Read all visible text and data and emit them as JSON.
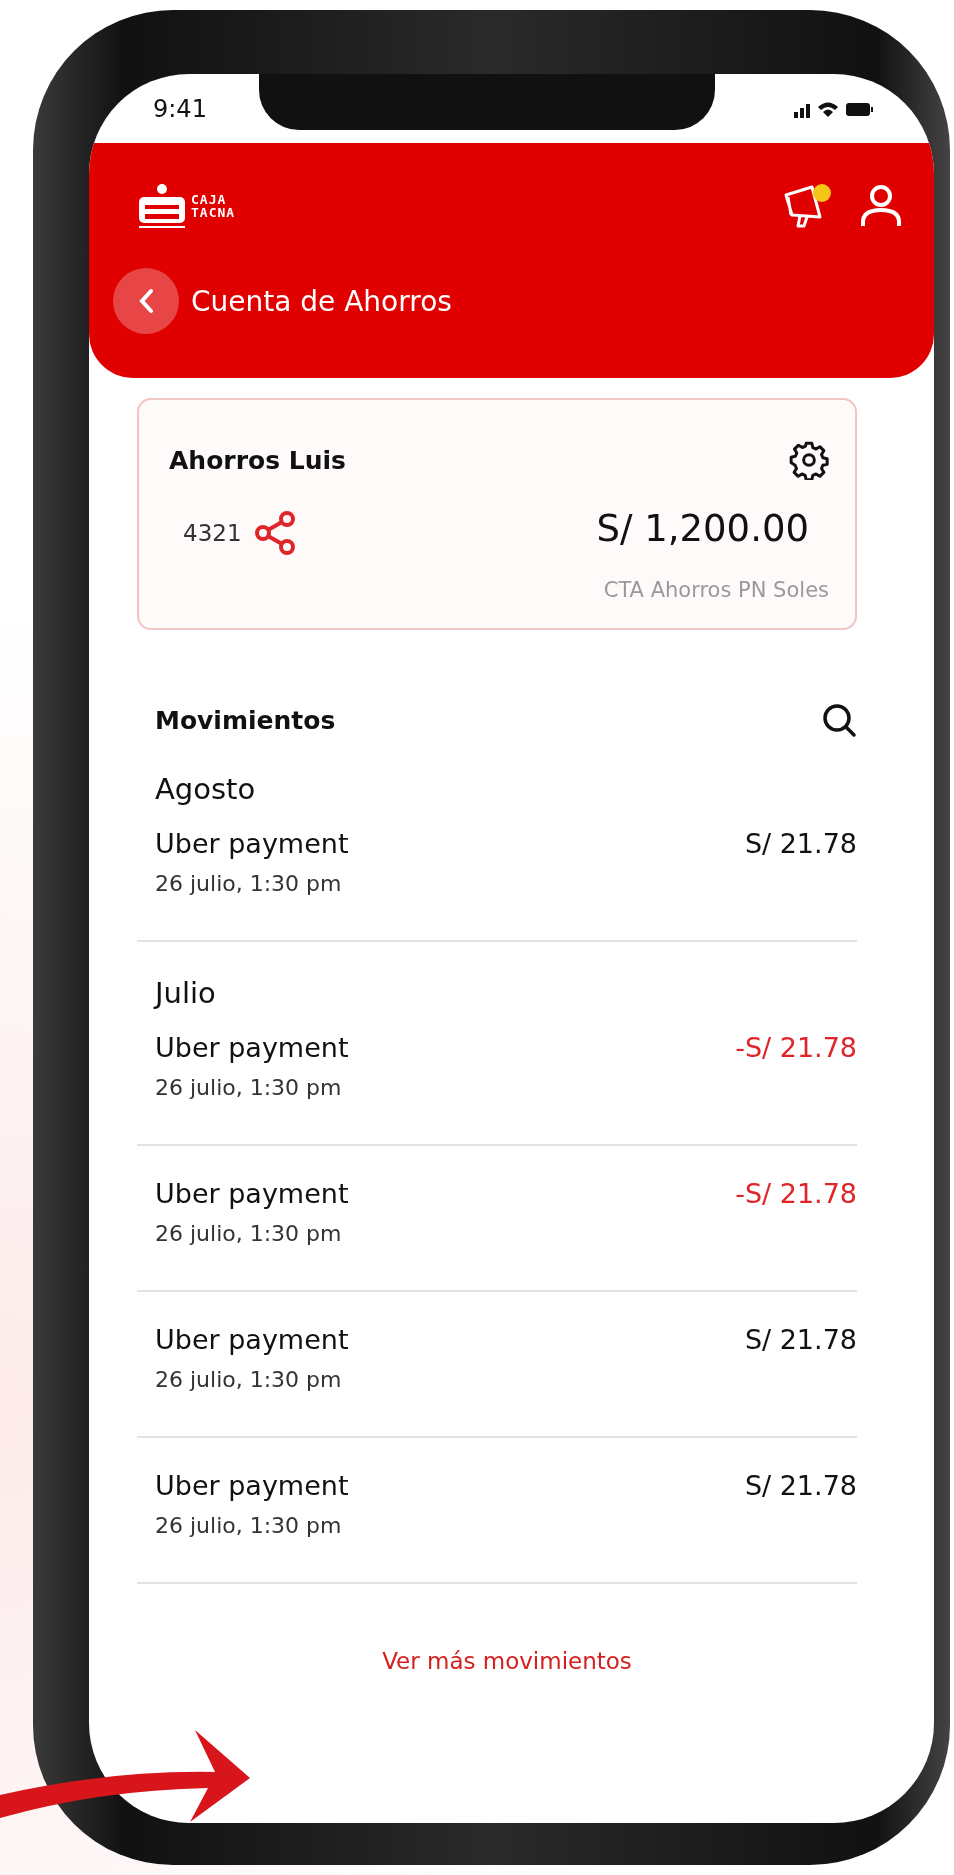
{
  "status_bar": {
    "time": "9:41"
  },
  "header": {
    "logo": {
      "line_1": "CAJA",
      "line_2": "TACNA"
    },
    "title": "Cuenta de Ahorros",
    "notification_dot": true
  },
  "account_card": {
    "name": "Ahorros Luis",
    "number": "4321",
    "balance": "S/ 1,200.00",
    "product": "CTA Ahorros PN Soles"
  },
  "movements": {
    "title": "Movimientos",
    "groups": [
      {
        "month": "Agosto",
        "items": [
          {
            "description": "Uber payment",
            "date": "26 julio, 1:30 pm",
            "amount": "S/ 21.78",
            "negative": false
          }
        ]
      },
      {
        "month": "Julio",
        "items": [
          {
            "description": "Uber payment",
            "date": "26 julio, 1:30 pm",
            "amount": "-S/ 21.78",
            "negative": true
          },
          {
            "description": "Uber payment",
            "date": "26 julio, 1:30 pm",
            "amount": "-S/ 21.78",
            "negative": true
          },
          {
            "description": "Uber payment",
            "date": "26 julio, 1:30 pm",
            "amount": "S/ 21.78",
            "negative": false
          },
          {
            "description": "Uber payment",
            "date": "26 julio, 1:30 pm",
            "amount": "S/ 21.78",
            "negative": false
          }
        ]
      }
    ]
  },
  "more_link": "Ver más movimientos"
}
